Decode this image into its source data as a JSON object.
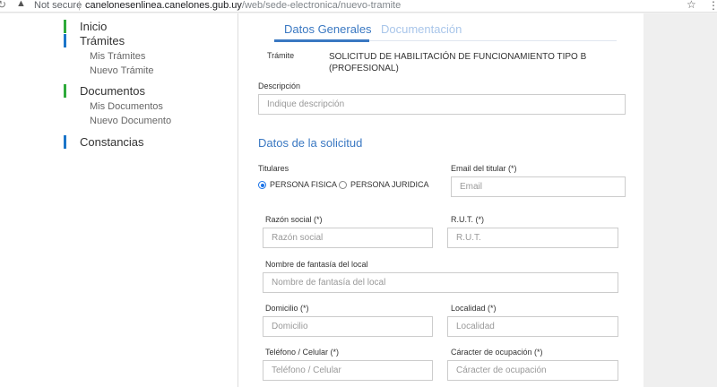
{
  "browser": {
    "security_label": "Not secure",
    "url_host": "canelonesenlinea.canelones.gub.uy",
    "url_path": "/web/sede-electronica/nuevo-tramite"
  },
  "sidebar": {
    "inicio": "Inicio",
    "tramites": "Trámites",
    "mis_tramites": "Mis Trámites",
    "nuevo_tramite": "Nuevo Trámite",
    "documentos": "Documentos",
    "mis_documentos": "Mis Documentos",
    "nuevo_documento": "Nuevo Documento",
    "constancias": "Constancias",
    "colors": {
      "inicio": "#2eaa3a",
      "tramites": "#1b75c9",
      "documentos": "#2eaa3a",
      "constancias": "#1b75c9"
    }
  },
  "tabs": {
    "general": "Datos Generales",
    "docs": "Documentación"
  },
  "tramite": {
    "label": "Trámite",
    "value_line1": "SOLICITUD DE HABILITACIÓN DE FUNCIONAMIENTO TIPO B",
    "value_line2": "(PROFESIONAL)"
  },
  "descripcion": {
    "label": "Descripción",
    "placeholder": "Indique descripción",
    "value": ""
  },
  "solicitud": {
    "title": "Datos de la solicitud",
    "titulares_label": "Titulares",
    "radio_fisica": "PERSONA FISICA",
    "radio_juridica": "PERSONA JURIDICA",
    "selected": "fisica",
    "email_label": "Email del titular (*)",
    "email_placeholder": "Email",
    "razon_label": "Razón social (*)",
    "razon_placeholder": "Razón social",
    "rut_label": "R.U.T. (*)",
    "rut_placeholder": "R.U.T.",
    "fantasia_label": "Nombre de fantasía del local",
    "fantasia_placeholder": "Nombre de fantasía del local",
    "domicilio_label": "Domicilio (*)",
    "domicilio_placeholder": "Domicilio",
    "localidad_label": "Localidad (*)",
    "localidad_placeholder": "Localidad",
    "telefono_label": "Teléfono / Celular (*)",
    "telefono_placeholder": "Teléfono / Celular",
    "caracter_label": "Cáracter de ocupación (*)",
    "caracter_placeholder": "Cáracter de ocupación"
  },
  "accent_color": "#3a78c2"
}
